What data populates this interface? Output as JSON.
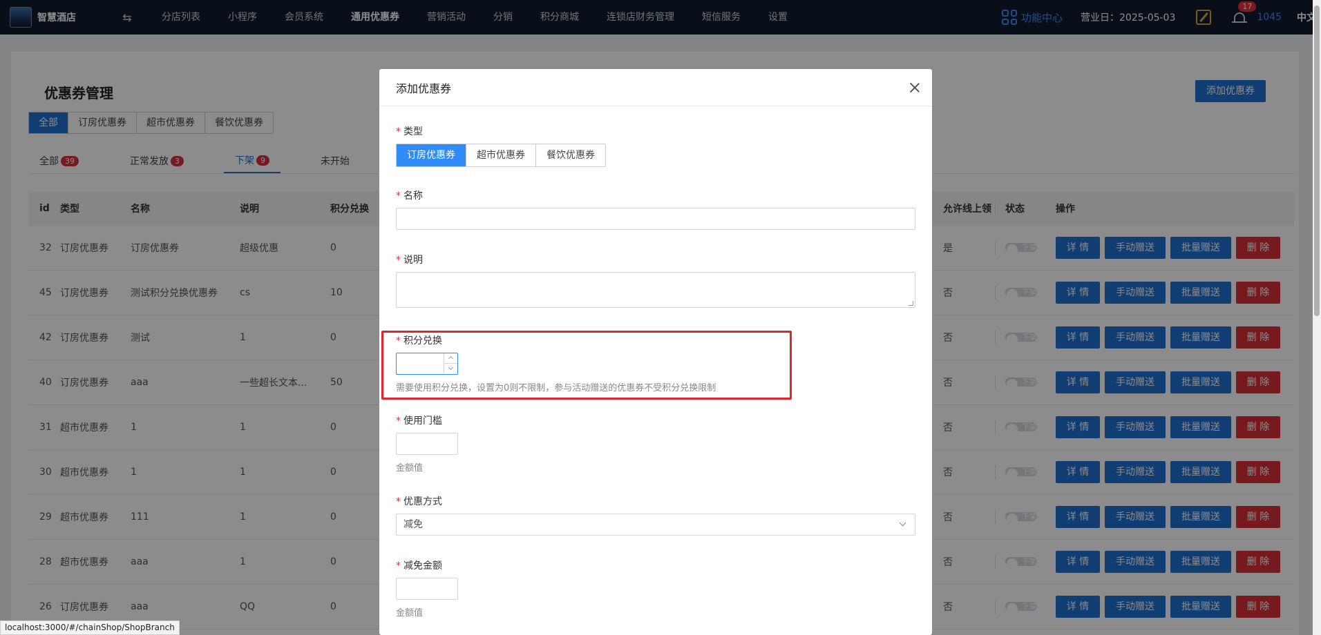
{
  "header": {
    "logo_text": "智慧酒店",
    "nav": [
      "分店列表",
      "小程序",
      "会员系统",
      "通用优惠券",
      "营销活动",
      "分销",
      "积分商城",
      "连锁店财务管理",
      "短信服务",
      "设置"
    ],
    "active_nav": "通用优惠券",
    "function_center": "功能中心",
    "business_date": "营业日：2025-05-03",
    "notification_count": "17",
    "user_id": "1045",
    "language": "中文"
  },
  "page": {
    "title": "优惠券管理",
    "add_button": "添加优惠券",
    "type_tabs": [
      "全部",
      "订房优惠券",
      "超市优惠券",
      "餐饮优惠券"
    ],
    "status_tabs": [
      {
        "label": "全部",
        "count": "39"
      },
      {
        "label": "正常发放",
        "count": "3"
      },
      {
        "label": "下架",
        "count": "9"
      },
      {
        "label": "未开始",
        "count": ""
      }
    ],
    "columns": [
      "id",
      "类型",
      "名称",
      "说明",
      "积分兑换",
      "允许线上领",
      "状态",
      "操作"
    ],
    "rows": [
      {
        "id": "32",
        "type": "订房优惠券",
        "name": "订房优惠券",
        "desc": "超级优惠",
        "points": "0",
        "online": "是"
      },
      {
        "id": "45",
        "type": "订房优惠券",
        "name": "测试积分兑换优惠券",
        "desc": "cs",
        "points": "10",
        "online": "否"
      },
      {
        "id": "42",
        "type": "订房优惠券",
        "name": "测试",
        "desc": "1",
        "points": "0",
        "online": "否"
      },
      {
        "id": "40",
        "type": "订房优惠券",
        "name": "aaa",
        "desc": "一些超长文本...",
        "points": "50",
        "online": "否"
      },
      {
        "id": "31",
        "type": "超市优惠券",
        "name": "1",
        "desc": "1",
        "points": "0",
        "online": "否"
      },
      {
        "id": "30",
        "type": "超市优惠券",
        "name": "1",
        "desc": "1",
        "points": "0",
        "online": "否"
      },
      {
        "id": "29",
        "type": "超市优惠券",
        "name": "111",
        "desc": "1",
        "points": "0",
        "online": "否"
      },
      {
        "id": "28",
        "type": "超市优惠券",
        "name": "aaa",
        "desc": "1",
        "points": "0",
        "online": "否"
      },
      {
        "id": "26",
        "type": "订房优惠券",
        "name": "aaa",
        "desc": "QQ",
        "points": "0",
        "online": "否"
      }
    ],
    "toggle_label": "下架",
    "ops": {
      "detail": "详 情",
      "manual": "手动赠送",
      "batch": "批量赠送",
      "delete": "删 除"
    }
  },
  "modal": {
    "title": "添加优惠券",
    "type_label": "类型",
    "type_options": [
      "订房优惠券",
      "超市优惠券",
      "餐饮优惠券"
    ],
    "type_selected": "订房优惠券",
    "name_label": "名称",
    "name_value": "",
    "desc_label": "说明",
    "desc_value": "",
    "points_label": "积分兑换",
    "points_value": "",
    "points_hint": "需要使用积分兑换，设置为0则不限制，参与活动赠送的优惠券不受积分兑换限制",
    "threshold_label": "使用门槛",
    "threshold_hint": "金额值",
    "discount_mode_label": "优惠方式",
    "discount_mode_value": "减免",
    "discount_amount_label": "减免金额",
    "discount_amount_hint": "金额值"
  },
  "statusbar": {
    "url": "localhost:3000/#/chainShop/ShopBranch"
  },
  "colors": {
    "primary": "#1e6fd0",
    "danger": "#d93038",
    "highlight": "#e0242c",
    "nav_bg": "#0f1d2e"
  }
}
